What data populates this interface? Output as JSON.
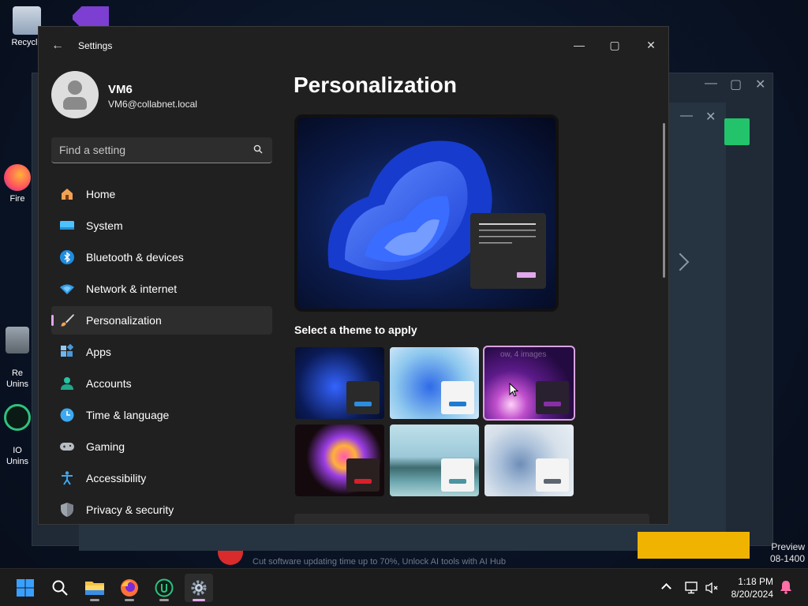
{
  "desktop": {
    "icons": [
      {
        "label": "Recycle"
      },
      {
        "label": "Fire"
      },
      {
        "label": "Re\nUnins"
      },
      {
        "label": "IO\nUnins"
      }
    ],
    "watermark": {
      "line1": "Preview",
      "line2": "08-1400"
    },
    "promo_text": "Cut software updating time up to 70%, Unlock AI tools with AI Hub"
  },
  "window": {
    "title": "Settings",
    "controls": {
      "minimize": "—",
      "maximize": "▢",
      "close": "✕"
    }
  },
  "profile": {
    "name": "VM6",
    "email": "VM6@collabnet.local"
  },
  "search": {
    "placeholder": "Find a setting"
  },
  "nav": {
    "items": [
      {
        "label": "Home",
        "icon": "home-icon"
      },
      {
        "label": "System",
        "icon": "system-icon"
      },
      {
        "label": "Bluetooth & devices",
        "icon": "bluetooth-icon"
      },
      {
        "label": "Network & internet",
        "icon": "network-icon"
      },
      {
        "label": "Personalization",
        "icon": "brush-icon",
        "active": true
      },
      {
        "label": "Apps",
        "icon": "apps-icon"
      },
      {
        "label": "Accounts",
        "icon": "accounts-icon"
      },
      {
        "label": "Time & language",
        "icon": "clock-icon"
      },
      {
        "label": "Gaming",
        "icon": "gamepad-icon"
      },
      {
        "label": "Accessibility",
        "icon": "accessibility-icon"
      },
      {
        "label": "Privacy & security",
        "icon": "shield-icon"
      }
    ]
  },
  "main": {
    "title": "Personalization",
    "theme_section_label": "Select a theme to apply",
    "selected_theme_caption": "ow, 4 images"
  },
  "taskbar": {
    "time": "1:18 PM",
    "date": "8/20/2024"
  },
  "colors": {
    "accent": "#e2a7ec",
    "window_bg": "#202020",
    "nav_active_bg": "#2d2d2d"
  }
}
